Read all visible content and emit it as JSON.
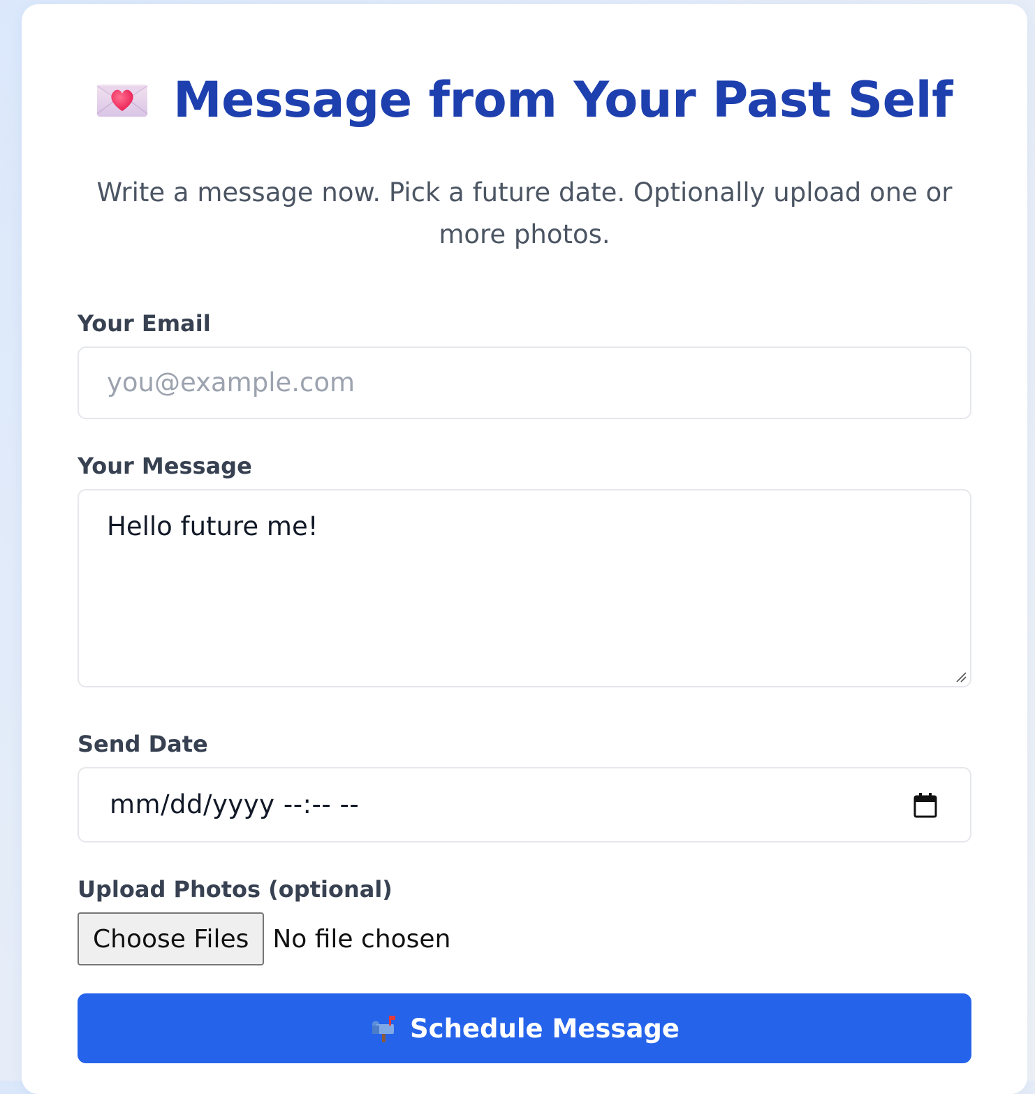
{
  "header": {
    "title": "Message from Your Past Self",
    "title_icon": "love-letter-icon",
    "subtitle": "Write a message now. Pick a future date. Optionally upload one or more photos."
  },
  "form": {
    "email": {
      "label": "Your Email",
      "placeholder": "you@example.com",
      "value": ""
    },
    "message": {
      "label": "Your Message",
      "value": "Hello future me!"
    },
    "send_date": {
      "label": "Send Date",
      "display": "mm/dd/yyyy --:-- --",
      "icon": "calendar-icon"
    },
    "photos": {
      "label": "Upload Photos (optional)",
      "button_label": "Choose Files",
      "status": "No file chosen"
    },
    "submit": {
      "label": "Schedule Message",
      "icon": "mailbox-icon"
    }
  },
  "colors": {
    "title": "#1e40af",
    "button": "#2563eb",
    "subtitle": "#4b5563",
    "label": "#374151",
    "placeholder": "#9ca3af",
    "field_border": "#e5e7eb"
  }
}
